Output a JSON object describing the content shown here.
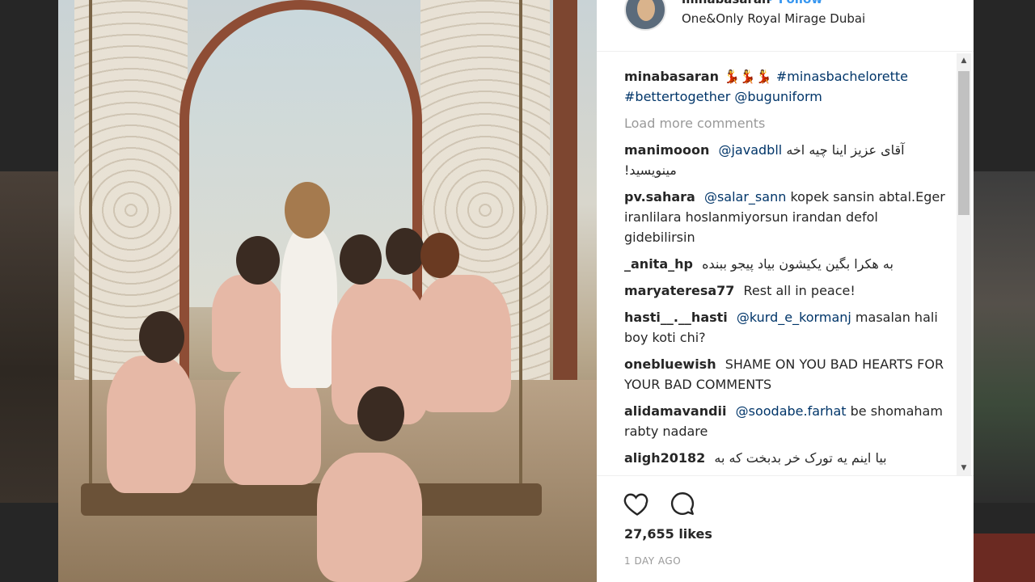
{
  "post": {
    "username": "minabasaran",
    "follow_label": "• Follow",
    "location": "One&Only Royal Mirage Dubai",
    "caption": {
      "username": "minabasaran",
      "emojis": "💃💃💃",
      "tag1": "#minasbachelorette",
      "tag2": "#bettertogether",
      "tag3": "@buguniform"
    },
    "load_more": "Load more comments",
    "comments": [
      {
        "user": "manimooon",
        "mention": "@javadbll",
        "text": "آقای عزیز اینا چیه اخه مینویسید!"
      },
      {
        "user": "pv.sahara",
        "mention": "@salar_sann",
        "text": "kopek sansin abtal.Eger iranlilara hoslanmiyorsun irandan defol gidebilirsin"
      },
      {
        "user": "_anita_hp",
        "mention": "",
        "text": "به هکرا بگین یکیشون بیاد پیجو ببنده"
      },
      {
        "user": "maryateresa77",
        "mention": "",
        "text": "Rest all in peace!"
      },
      {
        "user": "hasti__.__hasti",
        "mention": "@kurd_e_kormanj",
        "text": "masalan hali boy koti chi?"
      },
      {
        "user": "onebluewish",
        "mention": "",
        "text": "SHAME ON YOU BAD HEARTS FOR YOUR BAD COMMENTS"
      },
      {
        "user": "alidamavandii",
        "mention": "@soodabe.farhat",
        "text": "be shomaham rabty nadare"
      },
      {
        "user": "aligh20182",
        "mention": "",
        "text": "بیا اینم یه تورک خر بدبخت که به"
      }
    ],
    "likes": "27,655 likes",
    "timestamp": "1 DAY AGO",
    "icons": {
      "like": "heart-icon",
      "comment": "comment-bubble-icon"
    }
  }
}
